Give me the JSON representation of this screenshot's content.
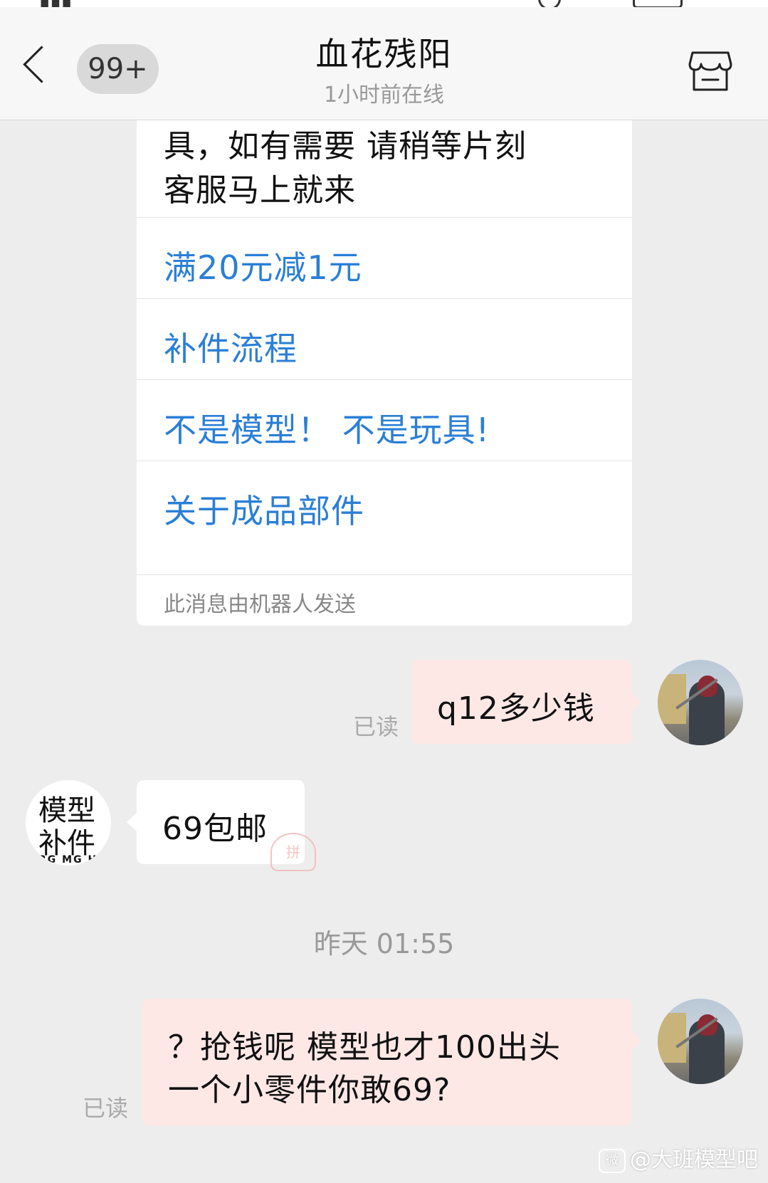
{
  "header": {
    "unread_badge": "99+",
    "contact_name": "血花残阳",
    "online_status": "1小时前在线"
  },
  "robot_card": {
    "intro_line1": "具，如有需要 请稍等片刻",
    "intro_line2": "客服马上就来",
    "options": [
      "满20元减1元",
      "补件流程",
      "不是模型！ 不是玩具!",
      "关于成品部件"
    ],
    "footer_note": "此消息由机器人发送"
  },
  "messages": {
    "msg1": {
      "text": "q12多少钱",
      "read_status": "已读"
    },
    "msg2": {
      "text": "69包邮",
      "avatar_line1": "模型",
      "avatar_line2": "补件",
      "avatar_line3": "RG MG HG"
    },
    "timestamp": "昨天 01:55",
    "msg3": {
      "line1": "？抢钱呢 模型也才100出头",
      "line2": "一个小零件你敢69?",
      "read_status": "已读"
    }
  },
  "watermark": {
    "text": "@大班模型吧"
  }
}
